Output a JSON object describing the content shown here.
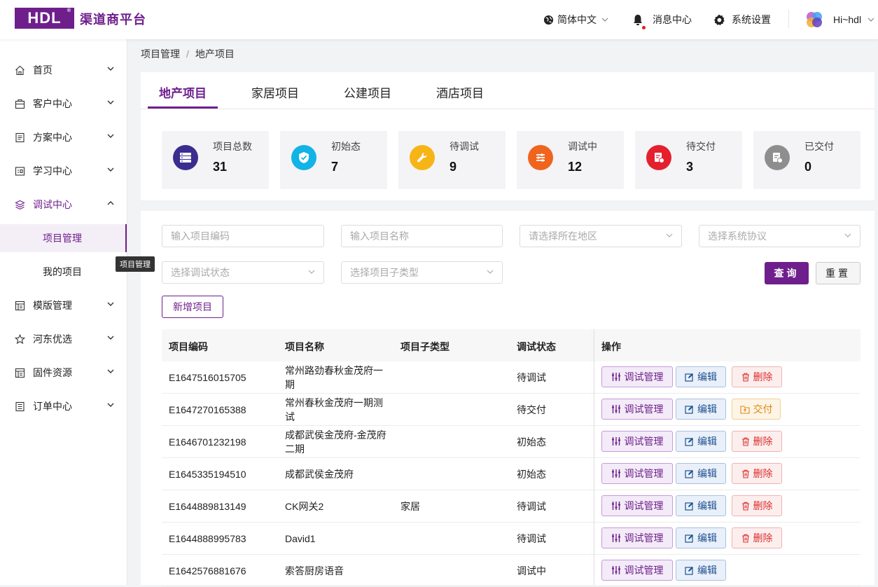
{
  "header": {
    "logo_text": "HDL",
    "brand": "渠道商平台",
    "language": "简体中文",
    "messages": "消息中心",
    "settings": "系统设置",
    "user": "Hi~hdl"
  },
  "sidebar": {
    "items": [
      {
        "label": "首页",
        "icon": "home-icon"
      },
      {
        "label": "客户中心",
        "icon": "customer-icon"
      },
      {
        "label": "方案中心",
        "icon": "document-icon"
      },
      {
        "label": "学习中心",
        "icon": "learning-icon"
      },
      {
        "label": "调试中心",
        "icon": "layers-icon"
      },
      {
        "label": "项目管理"
      },
      {
        "label": "我的项目"
      },
      {
        "label": "模版管理",
        "icon": "template-icon"
      },
      {
        "label": "河东优选",
        "icon": "star-icon"
      },
      {
        "label": "固件资源",
        "icon": "firmware-icon"
      },
      {
        "label": "订单中心",
        "icon": "order-icon"
      }
    ],
    "tooltip": "项目管理"
  },
  "breadcrumb": {
    "parent": "项目管理",
    "sep": "/",
    "current": "地产项目"
  },
  "tabs": [
    "地产项目",
    "家居项目",
    "公建项目",
    "酒店项目"
  ],
  "stats": [
    {
      "label": "项目总数",
      "value": "31",
      "color": "#3b2d8f"
    },
    {
      "label": "初始态",
      "value": "7",
      "color": "#12b3e6"
    },
    {
      "label": "待调试",
      "value": "9",
      "color": "#f7b416"
    },
    {
      "label": "调试中",
      "value": "12",
      "color": "#f0641e"
    },
    {
      "label": "待交付",
      "value": "3",
      "color": "#e5202e"
    },
    {
      "label": "已交付",
      "value": "0",
      "color": "#8e8e8e"
    }
  ],
  "filters": {
    "code_placeholder": "输入项目编码",
    "name_placeholder": "输入项目名称",
    "region_placeholder": "请选择所在地区",
    "protocol_placeholder": "选择系统协议",
    "status_placeholder": "选择调试状态",
    "subtype_placeholder": "选择项目子类型",
    "query": "查询",
    "reset": "重置",
    "add": "新增项目"
  },
  "table": {
    "headers": [
      "项目编码",
      "项目名称",
      "项目子类型",
      "调试状态",
      "操作"
    ],
    "rows": [
      {
        "code": "E1647516015705",
        "name": "常州路劲春秋金茂府一期",
        "subtype": "",
        "status": "待调试",
        "action3": "删除"
      },
      {
        "code": "E1647270165388",
        "name": "常州春秋金茂府一期测试",
        "subtype": "",
        "status": "待交付",
        "action3": "交付"
      },
      {
        "code": "E1646701232198",
        "name": "成都武侯金茂府-金茂府二期",
        "subtype": "",
        "status": "初始态",
        "action3": "删除"
      },
      {
        "code": "E1645335194510",
        "name": "成都武侯金茂府",
        "subtype": "",
        "status": "初始态",
        "action3": "删除"
      },
      {
        "code": "E1644889813149",
        "name": "CK网关2",
        "subtype": "家居",
        "status": "待调试",
        "action3": "删除"
      },
      {
        "code": "E1644888995783",
        "name": "David1",
        "subtype": "",
        "status": "待调试",
        "action3": "删除"
      },
      {
        "code": "E1642576881676",
        "name": "索答厨房语音",
        "subtype": "",
        "status": "调试中",
        "action3": ""
      }
    ],
    "action_debug": "调试管理",
    "action_edit": "编辑"
  }
}
